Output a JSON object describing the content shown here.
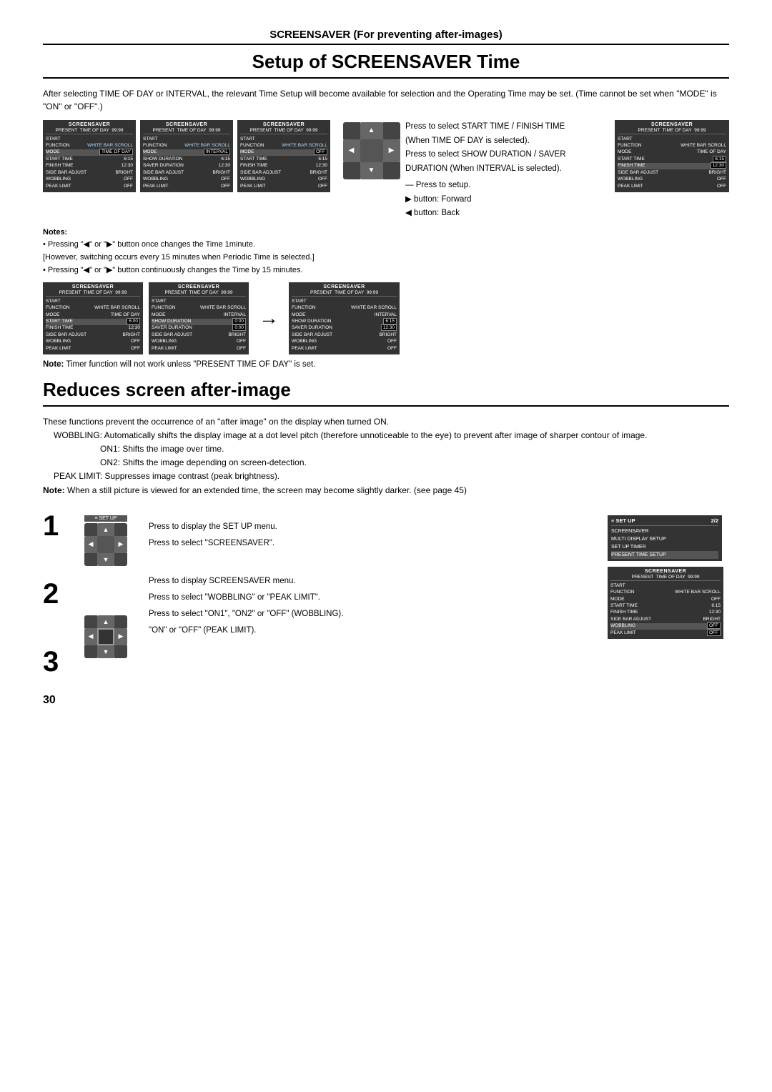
{
  "section1": {
    "header": "SCREENSAVER (For preventing after-images)",
    "title": "Setup of SCREENSAVER Time",
    "intro": "After selecting TIME OF DAY or INTERVAL, the relevant Time Setup will become available for selection and the Operating Time may be set. (Time cannot be set when \"MODE\" is \"ON\" or \"OFF\".)",
    "menu_boxes": [
      {
        "title": "SCREENSAVER",
        "subtitle": "PRESENT  TIME OF DAY  99:99",
        "rows": [
          {
            "label": "START",
            "val": ""
          },
          {
            "label": "FUNCTION",
            "val": "WHITE BAR SCROLL"
          },
          {
            "label": "MODE",
            "val": "TIME OF DAY",
            "bracket": true
          },
          {
            "label": "START TIME",
            "val": "6:15"
          },
          {
            "label": "FINISH TIME",
            "val": "12:30"
          },
          {
            "label": "SIDE BAR ADJUST",
            "val": "BRIGHT"
          },
          {
            "label": "WOBBLING",
            "val": "OFF"
          },
          {
            "label": "PEAK LIMIT",
            "val": "OFF"
          }
        ]
      },
      {
        "title": "SCREENSAVER",
        "subtitle": "PRESENT  TIME OF DAY  99:99",
        "rows": [
          {
            "label": "START",
            "val": ""
          },
          {
            "label": "FUNCTION",
            "val": "WHITE BAR SCROLL"
          },
          {
            "label": "MODE",
            "val": "INTERVAL",
            "bracket": true
          },
          {
            "label": "SHOW DURATION",
            "val": "6:15"
          },
          {
            "label": "SAVER DURATION",
            "val": "12:30"
          },
          {
            "label": "SIDE BAR ADJUST",
            "val": "BRIGHT"
          },
          {
            "label": "WOBBLING",
            "val": "OFF"
          },
          {
            "label": "PEAK LIMIT",
            "val": "OFF"
          }
        ]
      },
      {
        "title": "SCREENSAVER",
        "subtitle": "PRESENT  TIME OF DAY  99:99",
        "rows": [
          {
            "label": "START",
            "val": ""
          },
          {
            "label": "FUNCTION",
            "val": "WHITE BAR SCROLL"
          },
          {
            "label": "MODE",
            "val": "OFF",
            "bracket": true
          },
          {
            "label": "START TIME",
            "val": "6:15"
          },
          {
            "label": "FINISH TIME",
            "val": "12:30"
          },
          {
            "label": "SIDE BAR ADJUST",
            "val": "BRIGHT"
          },
          {
            "label": "WOBBLING",
            "val": "OFF"
          },
          {
            "label": "PEAK LIMIT",
            "val": "OFF"
          }
        ]
      }
    ],
    "right_box1": {
      "title": "SCREENSAVER",
      "subtitle": "PRESENT  TIME OF DAY  99:99",
      "rows": [
        {
          "label": "START",
          "val": ""
        },
        {
          "label": "FUNCTION",
          "val": "WHITE BAR SCROLL"
        },
        {
          "label": "MODE",
          "val": "TIME OF DAY"
        },
        {
          "label": "START TIME",
          "val": "6:15",
          "bracket": true
        },
        {
          "label": "FINISH TIME",
          "val": "12:30",
          "bracket": true,
          "highlight": true
        },
        {
          "label": "SIDE BAR ADJUST",
          "val": "BRIGHT"
        },
        {
          "label": "WOBBLING",
          "val": "OFF"
        },
        {
          "label": "PEAK LIMIT",
          "val": "OFF"
        }
      ]
    },
    "instructions": {
      "line1": "Press to select START TIME / FINISH TIME",
      "line1b": "(When TIME OF DAY is selected).",
      "line2": "Press to select SHOW DURATION / SAVER",
      "line2b": "DURATION (When INTERVAL is selected).",
      "line3": "Press to setup.",
      "line4": "▶ button: Forward",
      "line5": "◀ button: Back"
    },
    "notes": {
      "title": "Notes:",
      "note1": "• Pressing \"◀\" or \"▶\" button once changes the Time 1minute.",
      "note2": "[However, switching occurs every 15 minutes when Periodic Time is selected.]",
      "note3": "• Pressing \"◀\" or \"▶\" button continuously changes the Time by 15 minutes."
    },
    "menu_boxes2": [
      {
        "title": "SCREENSAVER",
        "subtitle": "PRESENT  TIME OF DAY  99:99",
        "rows": [
          {
            "label": "START",
            "val": ""
          },
          {
            "label": "FUNCTION",
            "val": "WHITE BAR SCROLL"
          },
          {
            "label": "MODE",
            "val": "TIME OF DAY"
          },
          {
            "label": "START TIME",
            "val": "6:00",
            "bracket": true,
            "highlight": true
          },
          {
            "label": "FINISH TIME",
            "val": "12:30"
          },
          {
            "label": "SIDE BAR ADJUST",
            "val": "BRIGHT"
          },
          {
            "label": "WOBBLING",
            "val": "OFF"
          },
          {
            "label": "PEAK LIMIT",
            "val": "OFF"
          }
        ]
      },
      {
        "title": "SCREENSAVER",
        "subtitle": "PRESENT  TIME OF DAY  99:99",
        "rows": [
          {
            "label": "START",
            "val": ""
          },
          {
            "label": "FUNCTION",
            "val": "WHITE BAR SCROLL"
          },
          {
            "label": "MODE",
            "val": "INTERVAL"
          },
          {
            "label": "SHOW DURATION",
            "val": "0:00",
            "bracket": true,
            "highlight": true
          },
          {
            "label": "SAVER DURATION",
            "val": "0:00",
            "bracket": true
          },
          {
            "label": "SIDE BAR ADJUST",
            "val": "BRIGHT"
          },
          {
            "label": "WOBBLING",
            "val": "OFF"
          },
          {
            "label": "PEAK LIMIT",
            "val": "OFF"
          }
        ]
      }
    ],
    "right_box2_title": "SCREENSAVER",
    "right_box2_subtitle": "PRESENT  TIME OF DAY  99:99",
    "right_box2_rows": [
      {
        "label": "START",
        "val": ""
      },
      {
        "label": "FUNCTION",
        "val": "WHITE BAR SCROLL"
      },
      {
        "label": "MODE",
        "val": "INTERVAL"
      },
      {
        "label": "SHOW DURATION",
        "val": "6:15",
        "bracket": true
      },
      {
        "label": "SAVER DURATION",
        "val": "12:30",
        "bracket": true
      },
      {
        "label": "SIDE BAR ADJUST",
        "val": "BRIGHT"
      },
      {
        "label": "WOBBLING",
        "val": "OFF"
      },
      {
        "label": "PEAK LIMIT",
        "val": "OFF"
      }
    ],
    "note_bottom": "Note: Timer function will not work unless \"PRESENT TIME OF DAY\" is set."
  },
  "section2": {
    "title": "Reduces screen after-image",
    "desc1": "These functions prevent the occurrence of an \"after image\" on the display when turned ON.",
    "desc2": " WOBBLING: Automatically shifts the display image at a dot level pitch (therefore unnoticeable to the eye) to prevent after image of sharper contour of image.",
    "desc3": "ON1:    Shifts the image over time.",
    "desc4": "ON2:    Shifts the image depending on screen-detection.",
    "desc5": " PEAK LIMIT: Suppresses image contrast (peak brightness).",
    "note_peak": "Note: When a still picture is viewed for an extended time, the screen may become slightly darker. (see page 45)",
    "steps": {
      "step1_label": "SET UP",
      "step1_desc": "Press to display the SET UP menu.",
      "step2_desc": "Press to select \"SCREENSAVER\".",
      "step3_desc1": "Press to display SCREENSAVER menu.",
      "step3_desc2": "Press to select \"WOBBLING\" or \"PEAK LIMIT\".",
      "step3_desc3": "Press to select \"ON1\", \"ON2\" or \"OFF\" (WOBBLING).",
      "step3_desc4": "\"ON\" or \"OFF\" (PEAK LIMIT)."
    },
    "setup_menu": {
      "title": "SET UP",
      "page": "2/2",
      "rows": [
        {
          "label": "SCREENSAVER",
          "selected": false
        },
        {
          "label": "MULTI DISPLAY SETUP",
          "selected": false
        },
        {
          "label": "SET UP TIMER",
          "selected": false
        },
        {
          "label": "PRESENT TIME SETUP",
          "selected": true
        }
      ]
    },
    "screensaver_final": {
      "title": "SCREENSAVER",
      "subtitle": "PRESENT  TIME OF DAY  99:99",
      "rows": [
        {
          "label": "START",
          "val": ""
        },
        {
          "label": "FUNCTION",
          "val": "WHITE BAR SCROLL"
        },
        {
          "label": "MODE",
          "val": "OFF"
        },
        {
          "label": "START TIME",
          "val": "6:15"
        },
        {
          "label": "FINISH TIME",
          "val": "12:30"
        },
        {
          "label": "SIDE BAR ADJUST",
          "val": "BRIGHT"
        },
        {
          "label": "WOBBLING",
          "val": "OFF",
          "bracket": true,
          "highlight": true
        },
        {
          "label": "PEAK LIMIT",
          "val": "OFF",
          "bracket": true
        }
      ]
    }
  },
  "page_number": "30"
}
